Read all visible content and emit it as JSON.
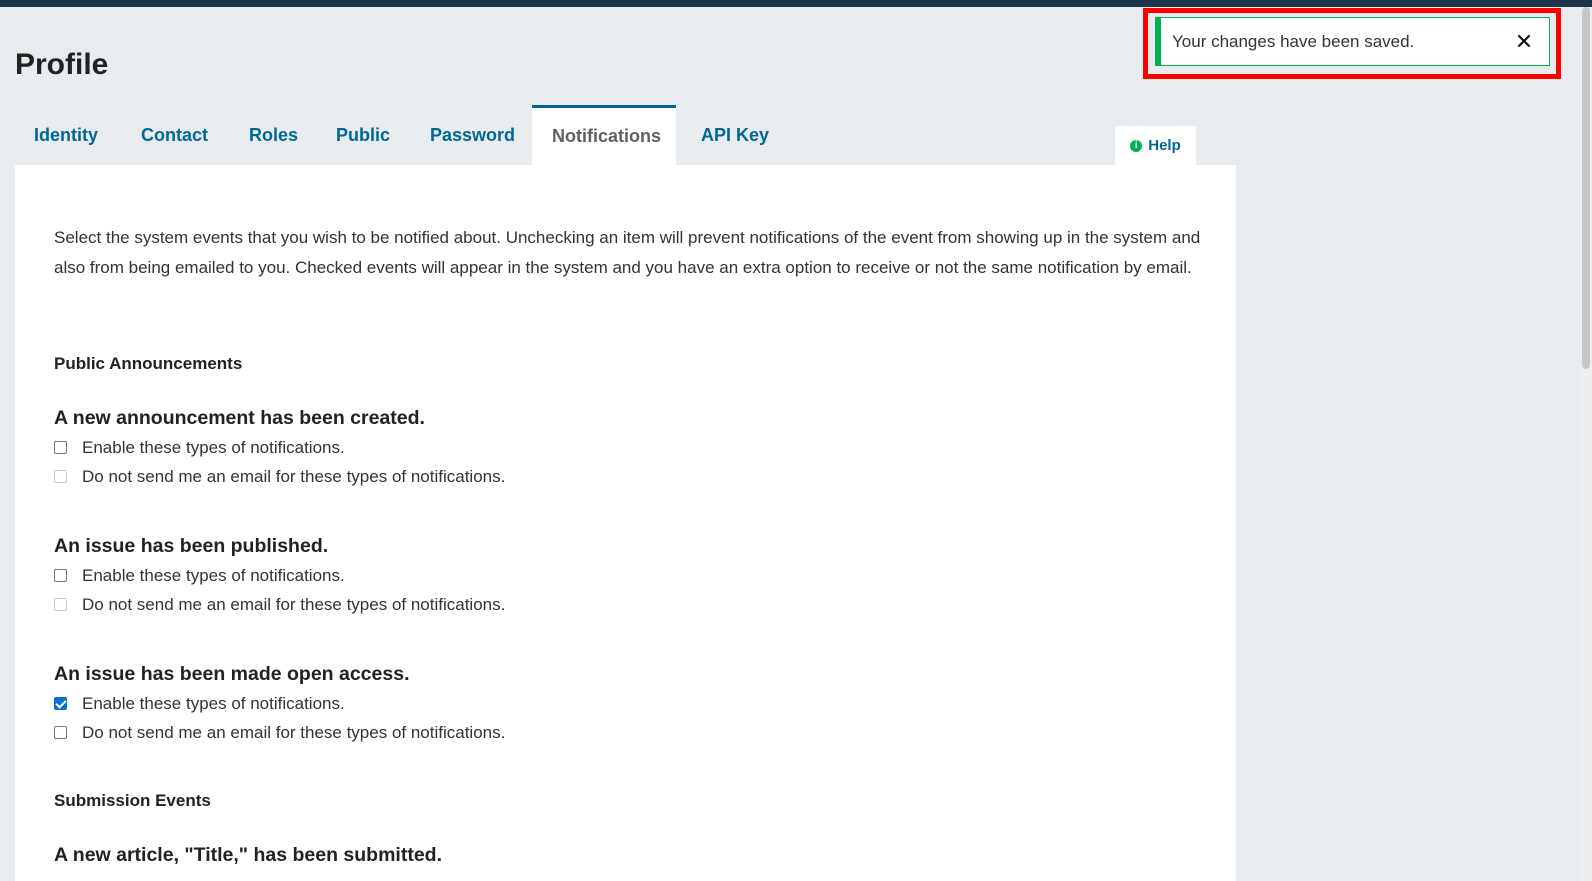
{
  "page": {
    "title": "Profile"
  },
  "tabs": [
    {
      "label": "Identity",
      "active": false
    },
    {
      "label": "Contact",
      "active": false
    },
    {
      "label": "Roles",
      "active": false
    },
    {
      "label": "Public",
      "active": false
    },
    {
      "label": "Password",
      "active": false
    },
    {
      "label": "Notifications",
      "active": true
    },
    {
      "label": "API Key",
      "active": false
    }
  ],
  "help": {
    "label": "Help",
    "icon": "info-icon"
  },
  "notifications": {
    "intro": "Select the system events that you wish to be notified about. Unchecking an item will prevent notifications of the event from showing up in the system and also from being emailed to you. Checked events will appear in the system and you have an extra option to receive or not the same notification by email.",
    "sections": [
      {
        "heading": "Public Announcements",
        "events": [
          {
            "title": "A new announcement has been created.",
            "enable_label": "Enable these types of notifications.",
            "enable_checked": false,
            "no_email_label": "Do not send me an email for these types of notifications.",
            "no_email_checked": false,
            "no_email_disabled": true
          },
          {
            "title": "An issue has been published.",
            "enable_label": "Enable these types of notifications.",
            "enable_checked": false,
            "no_email_label": "Do not send me an email for these types of notifications.",
            "no_email_checked": false,
            "no_email_disabled": true
          },
          {
            "title": "An issue has been made open access.",
            "enable_label": "Enable these types of notifications.",
            "enable_checked": true,
            "no_email_label": "Do not send me an email for these types of notifications.",
            "no_email_checked": false,
            "no_email_disabled": false
          }
        ]
      },
      {
        "heading": "Submission Events",
        "events": [
          {
            "title": "A new article, \"Title,\" has been submitted."
          }
        ]
      }
    ]
  },
  "toast": {
    "message": "Your changes have been saved.",
    "close_icon": "close-icon",
    "accent_color": "#00b24e",
    "highlight_color": "#ff0000"
  },
  "colors": {
    "link": "#006798",
    "header_bar": "#1c3548",
    "background": "#e9ecee"
  }
}
